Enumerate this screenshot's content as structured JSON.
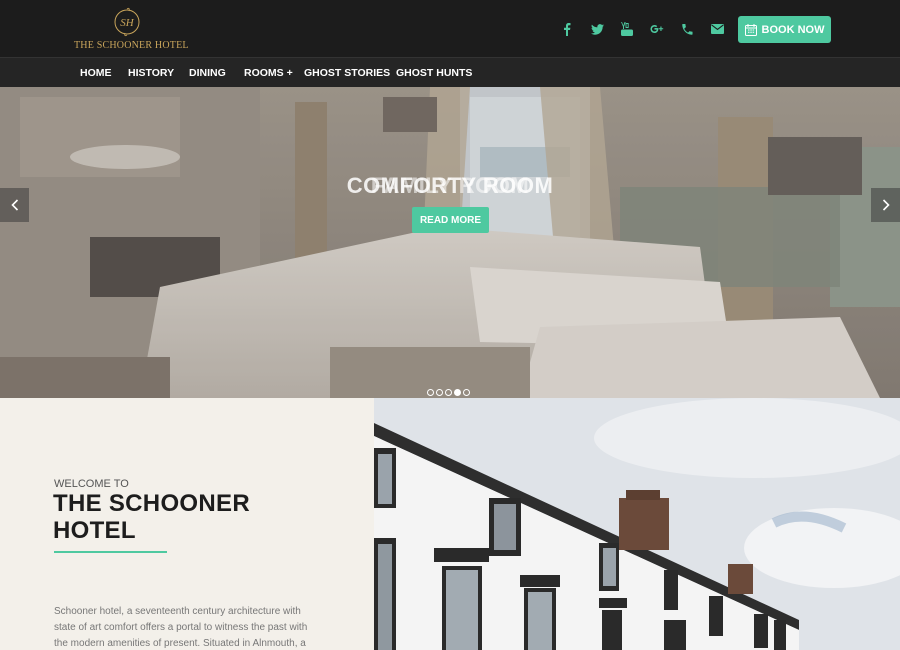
{
  "header": {
    "logo_monogram": "SH",
    "logo_text": "THE SCHOONER HOTEL",
    "social_icons": [
      "facebook-icon",
      "twitter-icon",
      "youtube-icon",
      "google-plus-icon",
      "phone-icon",
      "envelope-icon"
    ],
    "book_button": "BOOK NOW"
  },
  "nav": {
    "items": [
      "HOME",
      "HISTORY",
      "DINING",
      "ROOMS +",
      "GHOST STORIES",
      "GHOST HUNTS"
    ]
  },
  "hero": {
    "title": "COMFORTY ROOM",
    "title_ghost": "FAMILY ROOM",
    "read_more": "READ MORE",
    "slide_count": 5,
    "active_slide": 4
  },
  "welcome": {
    "kicker": "WELCOME TO",
    "title_line1": "THE SCHOONER",
    "title_line2": "HOTEL",
    "body": "Schooner hotel, a seventeenth century architecture with state of art comfort offers a portal to witness the past with the modern amenities of present. Situated in Alnmouth, a"
  },
  "colors": {
    "accent": "#4ec9a0",
    "gold": "#c9a55b",
    "header_bg": "#1c1c1c",
    "panel_bg": "#f3f0ea"
  }
}
